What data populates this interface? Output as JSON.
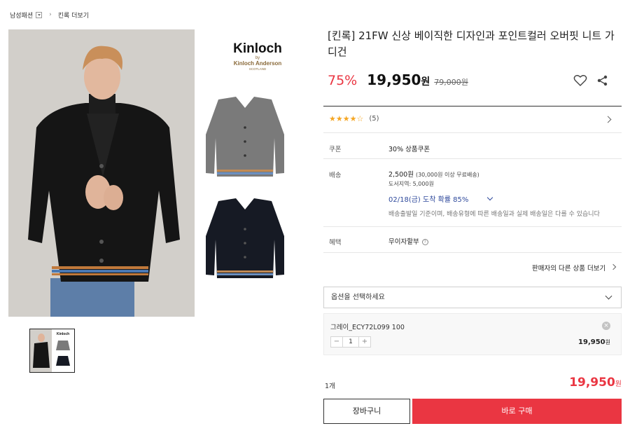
{
  "breadcrumb": {
    "category": "남성패션",
    "brand_more": "킨록 더보기"
  },
  "product": {
    "title": "[킨록] 21FW 신상 베이직한 디자인과 포인트컬러 오버핏 니트 가디건",
    "discount": "75%",
    "price": "19,950",
    "price_unit": "원",
    "original_price": "79,000원"
  },
  "brand_logo": {
    "name": "Kinloch",
    "by": "by",
    "maker": "Kinloch Anderson",
    "origin": "SCOTLAND"
  },
  "rating": {
    "stars": "★★★★☆",
    "count": "(5)"
  },
  "coupon": {
    "label": "쿠폰",
    "value": "30% 상품쿠폰"
  },
  "shipping": {
    "label": "배송",
    "fee": "2,500원",
    "fee_note": "(30,000원 이상 무료배송)",
    "island": "도서지역: 5,000원",
    "arrival": "02/18(금) 도착 확률 85%",
    "note": "배송출발일 기준이며, 배송유형에 따른 배송일과 실제 배송일은 다를 수 있습니다"
  },
  "benefit": {
    "label": "혜택",
    "value": "무이자할부",
    "info": "?"
  },
  "seller_more": "판매자의 다른 상품 더보기",
  "option_select": {
    "placeholder": "옵션을 선택하세요"
  },
  "selected_option": {
    "name": "그레이_ECY72L099 100",
    "minus": "−",
    "quantity": "1",
    "plus": "+",
    "price": "19,950",
    "unit": "원",
    "remove": "×"
  },
  "summary": {
    "count": "1개",
    "total": "19,950",
    "unit": "원"
  },
  "buttons": {
    "cart": "장바구니",
    "buy": "바로 구매"
  },
  "colors": {
    "accent": "#ea3642",
    "arrival": "#2f4a9c",
    "star": "#f5a623"
  }
}
